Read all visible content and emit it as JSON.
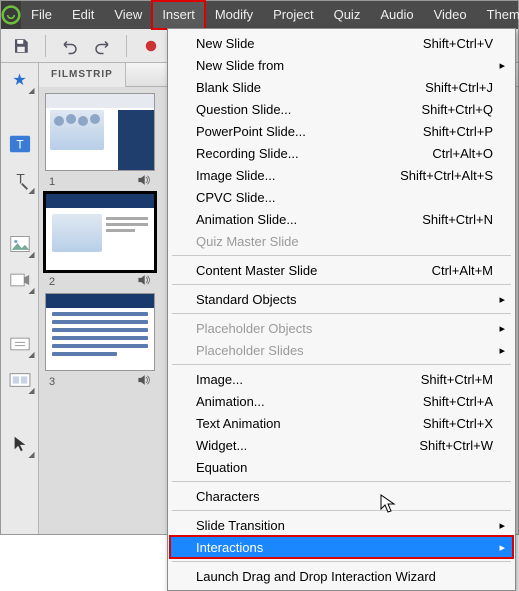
{
  "menubar": {
    "items": [
      "File",
      "Edit",
      "View",
      "Insert",
      "Modify",
      "Project",
      "Quiz",
      "Audio",
      "Video",
      "Themes"
    ],
    "highlighted_index": 3
  },
  "filmstrip": {
    "tab_label": "FILMSTRIP",
    "slides": [
      {
        "num": "1",
        "audio": true
      },
      {
        "num": "2",
        "audio": true
      },
      {
        "num": "3",
        "audio": true
      }
    ]
  },
  "dropdown": {
    "groups": [
      [
        {
          "label": "New Slide",
          "shortcut": "Shift+Ctrl+V"
        },
        {
          "label": "New Slide from",
          "submenu": true
        },
        {
          "label": "Blank Slide",
          "shortcut": "Shift+Ctrl+J"
        },
        {
          "label": "Question Slide...",
          "shortcut": "Shift+Ctrl+Q"
        },
        {
          "label": "PowerPoint Slide...",
          "shortcut": "Shift+Ctrl+P"
        },
        {
          "label": "Recording Slide...",
          "shortcut": "Ctrl+Alt+O"
        },
        {
          "label": "Image Slide...",
          "shortcut": "Shift+Ctrl+Alt+S"
        },
        {
          "label": "CPVC Slide..."
        },
        {
          "label": "Animation Slide...",
          "shortcut": "Shift+Ctrl+N"
        },
        {
          "label": "Quiz Master Slide",
          "disabled": true
        }
      ],
      [
        {
          "label": "Content Master Slide",
          "shortcut": "Ctrl+Alt+M"
        }
      ],
      [
        {
          "label": "Standard Objects",
          "submenu": true
        }
      ],
      [
        {
          "label": "Placeholder Objects",
          "submenu": true,
          "disabled": true
        },
        {
          "label": "Placeholder Slides",
          "submenu": true,
          "disabled": true
        }
      ],
      [
        {
          "label": "Image...",
          "shortcut": "Shift+Ctrl+M"
        },
        {
          "label": "Animation...",
          "shortcut": "Shift+Ctrl+A"
        },
        {
          "label": "Text Animation",
          "shortcut": "Shift+Ctrl+X"
        },
        {
          "label": "Widget...",
          "shortcut": "Shift+Ctrl+W"
        },
        {
          "label": "Equation"
        }
      ],
      [
        {
          "label": "Characters"
        }
      ],
      [
        {
          "label": "Slide Transition",
          "submenu": true
        },
        {
          "label": "Interactions",
          "submenu": true,
          "highlighted": true,
          "boxed": true
        }
      ],
      [
        {
          "label": "Launch Drag and Drop Interaction Wizard"
        }
      ]
    ]
  }
}
